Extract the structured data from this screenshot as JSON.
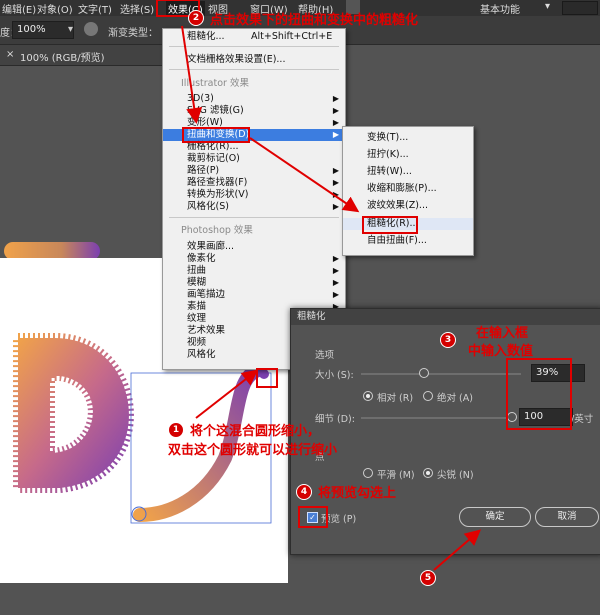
{
  "menubar": {
    "items": [
      "编辑(E)",
      "对象(O)",
      "文字(T)",
      "选择(S)",
      "效果(C)",
      "视图",
      "窗口(W)",
      "帮助(H)"
    ],
    "workspace": "基本功能"
  },
  "controlbar": {
    "degree_label": "度：",
    "zoom_value": "100%",
    "gradient_type_label": "渐变类型："
  },
  "document_tab": {
    "title": "100% (RGB/预览)"
  },
  "effect_menu": {
    "rows": [
      {
        "label": "粗糙化...",
        "shortcut": "Alt+Shift+Ctrl+E"
      },
      {
        "label": "文档栅格效果设置(E)..."
      },
      {
        "label": "Illustrator 效果",
        "section": true
      },
      {
        "label": "3D(3)",
        "submenu": true
      },
      {
        "label": "SVG 滤镜(G)",
        "submenu": true
      },
      {
        "label": "变形(W)",
        "submenu": true
      },
      {
        "label": "扭曲和变换(D)",
        "submenu": true,
        "highlighted": true
      },
      {
        "label": "栅格化(R)..."
      },
      {
        "label": "裁剪标记(O)"
      },
      {
        "label": "路径(P)",
        "submenu": true
      },
      {
        "label": "路径查找器(F)",
        "submenu": true
      },
      {
        "label": "转换为形状(V)",
        "submenu": true
      },
      {
        "label": "风格化(S)",
        "submenu": true
      },
      {
        "label": "Photoshop 效果",
        "section": true
      },
      {
        "label": "效果画廊..."
      },
      {
        "label": "像素化",
        "submenu": true
      },
      {
        "label": "扭曲",
        "submenu": true
      },
      {
        "label": "模糊",
        "submenu": true
      },
      {
        "label": "画笔描边",
        "submenu": true
      },
      {
        "label": "素描",
        "submenu": true
      },
      {
        "label": "纹理",
        "submenu": true
      },
      {
        "label": "艺术效果",
        "submenu": true
      },
      {
        "label": "视频",
        "submenu": true
      },
      {
        "label": "风格化",
        "submenu": true
      }
    ]
  },
  "distort_submenu": {
    "rows": [
      {
        "label": "变换(T)..."
      },
      {
        "label": "扭拧(K)..."
      },
      {
        "label": "扭转(W)..."
      },
      {
        "label": "收缩和膨胀(P)..."
      },
      {
        "label": "波纹效果(Z)..."
      },
      {
        "label": "粗糙化(R)...",
        "highlighted": true
      },
      {
        "label": "自由扭曲(F)..."
      }
    ]
  },
  "roughen_dialog": {
    "title": "粗糙化",
    "options_label": "选项",
    "size_label": "大小 (S):",
    "size_value": "39%",
    "relative_label": "相对 (R)",
    "absolute_label": "绝对 (A)",
    "detail_label": "细节 (D):",
    "detail_value": "100",
    "detail_unit": "/英寸",
    "point_label": "点",
    "smooth_label": "平滑 (M)",
    "corner_label": "尖锐 (N)",
    "preview_label": "预览 (P)",
    "ok_label": "确定",
    "cancel_label": "取消",
    "size_fraction": 0.39,
    "detail_fraction": 1.0
  },
  "annotations": {
    "step1_badge": "1",
    "step1_line1": "将个这混合圆形缩小，",
    "step1_line2": "双击这个圆形就可以进行缩小",
    "step2_badge": "2",
    "step2_text": "点击效果下的扭曲和变换中的粗糙化",
    "step3_badge": "3",
    "step3_line1": "在输入框",
    "step3_line2": "中输入数值",
    "step4_badge": "4",
    "step4_text": "将预览勾选上",
    "step5_badge": "5"
  },
  "colors": {
    "accent_red": "#e00000",
    "menu_highlight": "#3c7de0",
    "gradient_start": "#f0a24a",
    "gradient_end": "#7b3fb0"
  }
}
